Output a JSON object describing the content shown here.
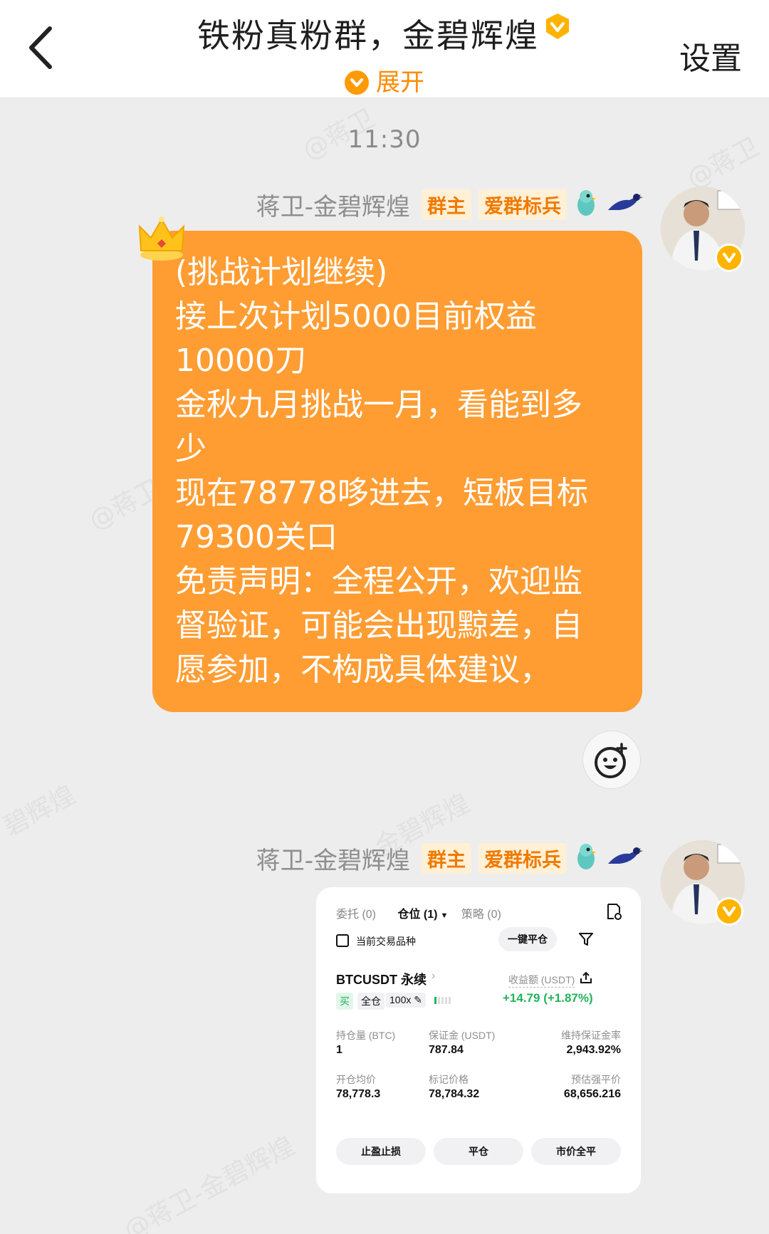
{
  "header": {
    "title": "铁粉真粉群，金碧辉煌",
    "expand_label": "展开",
    "settings_label": "设置"
  },
  "chat": {
    "timestamp": "11:30",
    "messages": [
      {
        "sender": "蒋卫-金碧辉煌",
        "tags": [
          "群主",
          "爱群标兵"
        ],
        "lines": [
          "(挑战计划继续)",
          "接上次计划5000目前权益",
          "10000刀",
          "金秋九月挑战一月，看能到多",
          "少",
          "现在78778哆进去，短板目标",
          "79300关口",
          "免责声明：全程公开，欢迎监",
          "督验证，可能会出现黥差，自",
          "愿参加，不构成具体建议，"
        ]
      },
      {
        "sender": "蒋卫-金碧辉煌",
        "tags": [
          "群主",
          "爱群标兵"
        ]
      }
    ]
  },
  "trade_card": {
    "tabs": [
      "委托 (0)",
      "仓位 (1)",
      "策略 (0)"
    ],
    "filter_label": "当前交易品种",
    "close_all_label": "一键平仓",
    "symbol": "BTCUSDT 永续",
    "side_tag": "买",
    "margin_mode": "全仓",
    "leverage": "100x",
    "pnl_label": "收益额 (USDT)",
    "pnl_value": "+14.79 (+1.87%)",
    "stats": [
      {
        "label": "持仓量 (BTC)",
        "value": "1"
      },
      {
        "label": "保证金 (USDT)",
        "value": "787.84"
      },
      {
        "label": "维持保证金率",
        "value": "2,943.92%"
      },
      {
        "label": "开仓均价",
        "value": "78,778.3"
      },
      {
        "label": "标记价格",
        "value": "78,784.32"
      },
      {
        "label": "预估强平价",
        "value": "68,656.216"
      }
    ],
    "actions": [
      "止盈止损",
      "平仓",
      "市价全平"
    ]
  },
  "colors": {
    "accent": "#ff9d33",
    "profit": "#21b35b",
    "tag_text": "#f07a00"
  }
}
